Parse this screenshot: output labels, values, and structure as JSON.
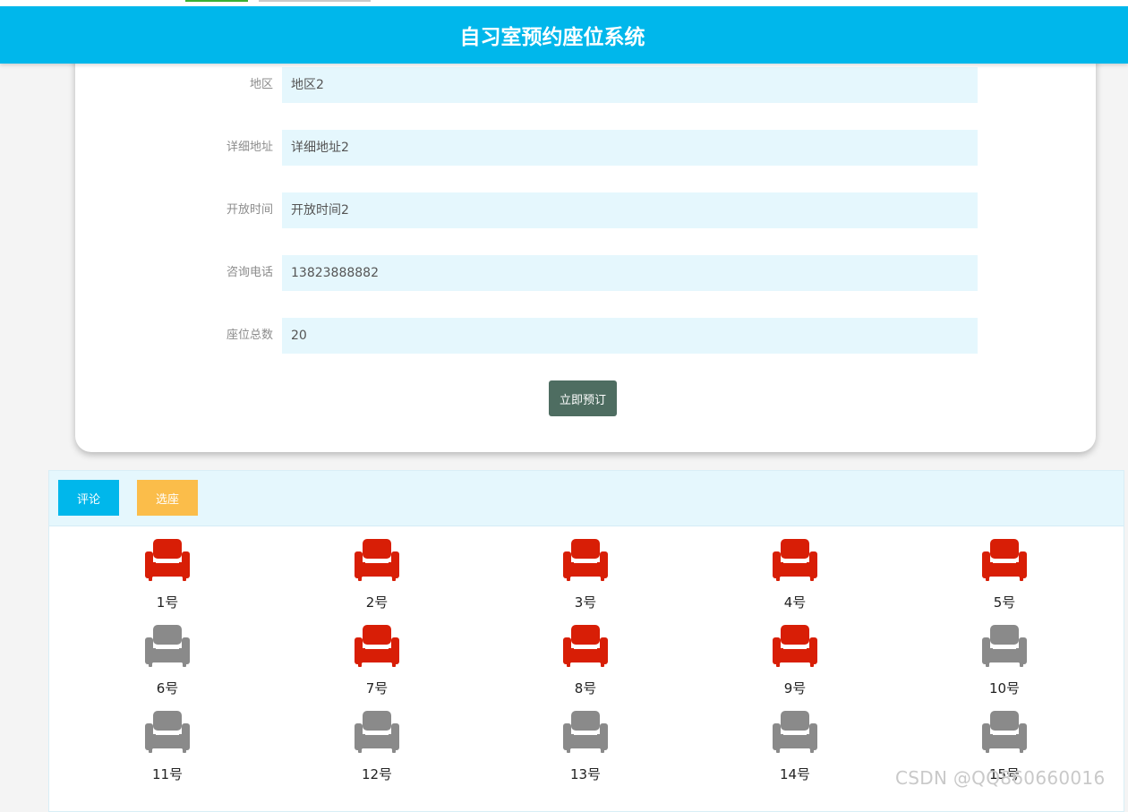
{
  "header": {
    "title": "自习室预约座位系统"
  },
  "form": {
    "rows": [
      {
        "label": "地区",
        "value": "地区2"
      },
      {
        "label": "详细地址",
        "value": "详细地址2"
      },
      {
        "label": "开放时间",
        "value": "开放时间2"
      },
      {
        "label": "咨询电话",
        "value": "13823888882"
      },
      {
        "label": "座位总数",
        "value": "20"
      }
    ],
    "book_label": "立即预订"
  },
  "tabs": {
    "comment_label": "评论",
    "seat_label": "选座"
  },
  "colors": {
    "header": "#00b7eb",
    "occupied": "#d81e06",
    "available": "#8a8a8a",
    "book_button": "#4e6d61",
    "comment_tab": "#00b7eb",
    "seat_tab": "#fbbd4a"
  },
  "seats": [
    {
      "label": "1号",
      "status": "occupied"
    },
    {
      "label": "2号",
      "status": "occupied"
    },
    {
      "label": "3号",
      "status": "occupied"
    },
    {
      "label": "4号",
      "status": "occupied"
    },
    {
      "label": "5号",
      "status": "occupied"
    },
    {
      "label": "6号",
      "status": "available"
    },
    {
      "label": "7号",
      "status": "occupied"
    },
    {
      "label": "8号",
      "status": "occupied"
    },
    {
      "label": "9号",
      "status": "occupied"
    },
    {
      "label": "10号",
      "status": "available"
    },
    {
      "label": "11号",
      "status": "available"
    },
    {
      "label": "12号",
      "status": "available"
    },
    {
      "label": "13号",
      "status": "available"
    },
    {
      "label": "14号",
      "status": "available"
    },
    {
      "label": "15号",
      "status": "available"
    }
  ],
  "watermark": "CSDN @QQ860660016"
}
